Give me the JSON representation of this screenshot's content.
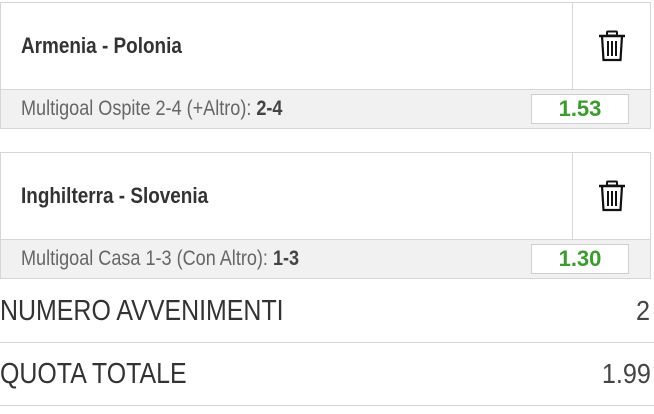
{
  "events": [
    {
      "match": "Armenia - Polonia",
      "selection_label": "Multigoal Ospite 2-4 (+Altro): ",
      "selection_value": "2-4",
      "odds": "1.53",
      "delete_icon": "trash-icon"
    },
    {
      "match": "Inghilterra - Slovenia",
      "selection_label": "Multigoal Casa 1-3 (Con Altro): ",
      "selection_value": "1-3",
      "odds": "1.30",
      "delete_icon": "trash-icon"
    }
  ],
  "summary": {
    "events_label": "NUMERO AVVENIMENTI",
    "events_value": "2",
    "total_odds_label": "QUOTA TOTALE",
    "total_odds_value": "1.99"
  },
  "colors": {
    "odds_green": "#3c9a2e",
    "selection_bg": "#f1f1f1",
    "border": "#d6d6d6"
  }
}
